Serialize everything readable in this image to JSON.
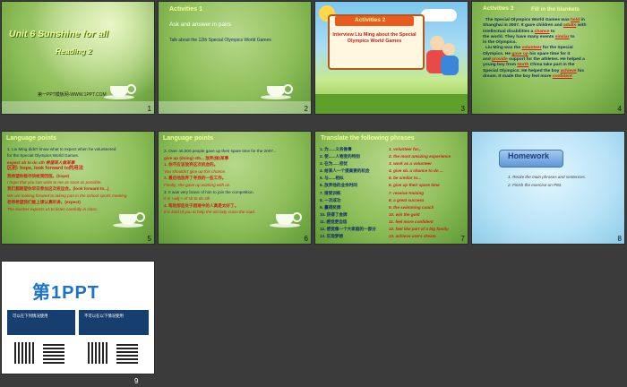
{
  "slides": [
    {
      "n": "1",
      "title": "Unit 6 Sunshine for all",
      "subtitle": "Reading 2",
      "footer": "第一PPT模板网-WWW.1PPT.COM"
    },
    {
      "n": "2",
      "title": "Activities 1",
      "subtitle": "Ask and answer in pairs",
      "body": "Talk about the 12th  Special Olympics World Games"
    },
    {
      "n": "3",
      "title": "Activities 2",
      "body": "Interview Liu Ming about the Special Olympics World Games"
    },
    {
      "n": "4",
      "title": "Activities  3",
      "subtitle": "Fill in the blankets",
      "lines": [
        "The Special Olympics World Games was",
        "Shanghai in 2007. It gave children and",
        "intellectual disabilities a",
        "the world. They have many events",
        "in the Olympics.",
        "Liu Ming was the",
        "for the Special",
        "Olympics. He",
        "his spare time for it",
        "and",
        "support for the athletes. He helped a",
        "young boy from",
        "China take part in the",
        "Special Olympics. He helped the boy",
        "his",
        "dream. It  made the boy feel more"
      ],
      "blanks": [
        "held",
        "adults",
        "chance",
        "similar",
        "volunteer",
        "gave up",
        "provide",
        "North",
        "achieve",
        "confident"
      ],
      "fragments": {
        "with": "with",
        "to": "to",
        "in": "in"
      }
    },
    {
      "n": "5",
      "title": "Language points",
      "lines": [
        "1. Liu Ming didn't know what to expect when he volunteered",
        "for the Special Olympics World Games.",
        "expect sb to do sth    希望某人做某事",
        "区别: hope, look forward to的用法",
        "我希望你能尽快给我回信。(hope)",
        "I hope that you can write to me as soon as possible.",
        "我们都期望你早日参加这次校运会。(look forward to...)",
        "We are looking forward to taking part in the school sports meeting",
        "老师希望我们能上课认真听讲。(expect)",
        "The teacher expects us to listen carefully in class."
      ]
    },
    {
      "n": "6",
      "title": "Language points",
      "lines": [
        "2. Over 40,000 people gave up their spare time  for the 2007...",
        "give up   (doing) sth... 放弃(做)某事",
        "1. 你不应该放弃这次机会的。",
        "You shouldn't give up this chance.",
        "2. 最后他放弃了寻找的一些工作。",
        "Finally, she gave up working with us.",
        "3. It was very brave of him to join the competition.",
        "It is +adj + of sb   to do sth",
        "4. 帮助那些处于困难中的人真是太好了。",
        "It is kind of you to help the old lady cross the road."
      ]
    },
    {
      "n": "7",
      "title": "Translate the following  phrases",
      "left": [
        "1.  为......义务做事",
        "2.  使......人物变的特别",
        "3.  在为......担忧",
        "4.  给某人一个提高要的机会",
        "5.  与......相似",
        "6.  放弃他的业余时间",
        "7.  接受训练",
        "8.  一次成功",
        "9.  赢得奖牌",
        "10. 获得了金牌",
        "11. 感觉更自信",
        "12. 感觉像一个大家庭的一部分",
        "13. 实现梦想"
      ],
      "right": [
        "1.  volunteer for...",
        "2.  the most amazing experience",
        "3.  work as a volunteer",
        "4.  give sb. a chance to do ...",
        "5.  be similar to...",
        "6.  give up their spare time",
        "7.  receive training",
        "8.  a great success",
        "9.  the swimming coach",
        "10. win the gold",
        "11. feel more confident",
        "12. feel like part of a big family",
        "13. achieve one's dream"
      ]
    },
    {
      "n": "8",
      "title": "Homework",
      "items": [
        "1. Recite the main phrases and sentences.",
        "2. Finish the exercise on P83."
      ]
    },
    {
      "n": "9",
      "logo": "第1PPT",
      "boxes": [
        "可以在下列情况使用",
        "不可以在以下情况使用"
      ]
    }
  ]
}
